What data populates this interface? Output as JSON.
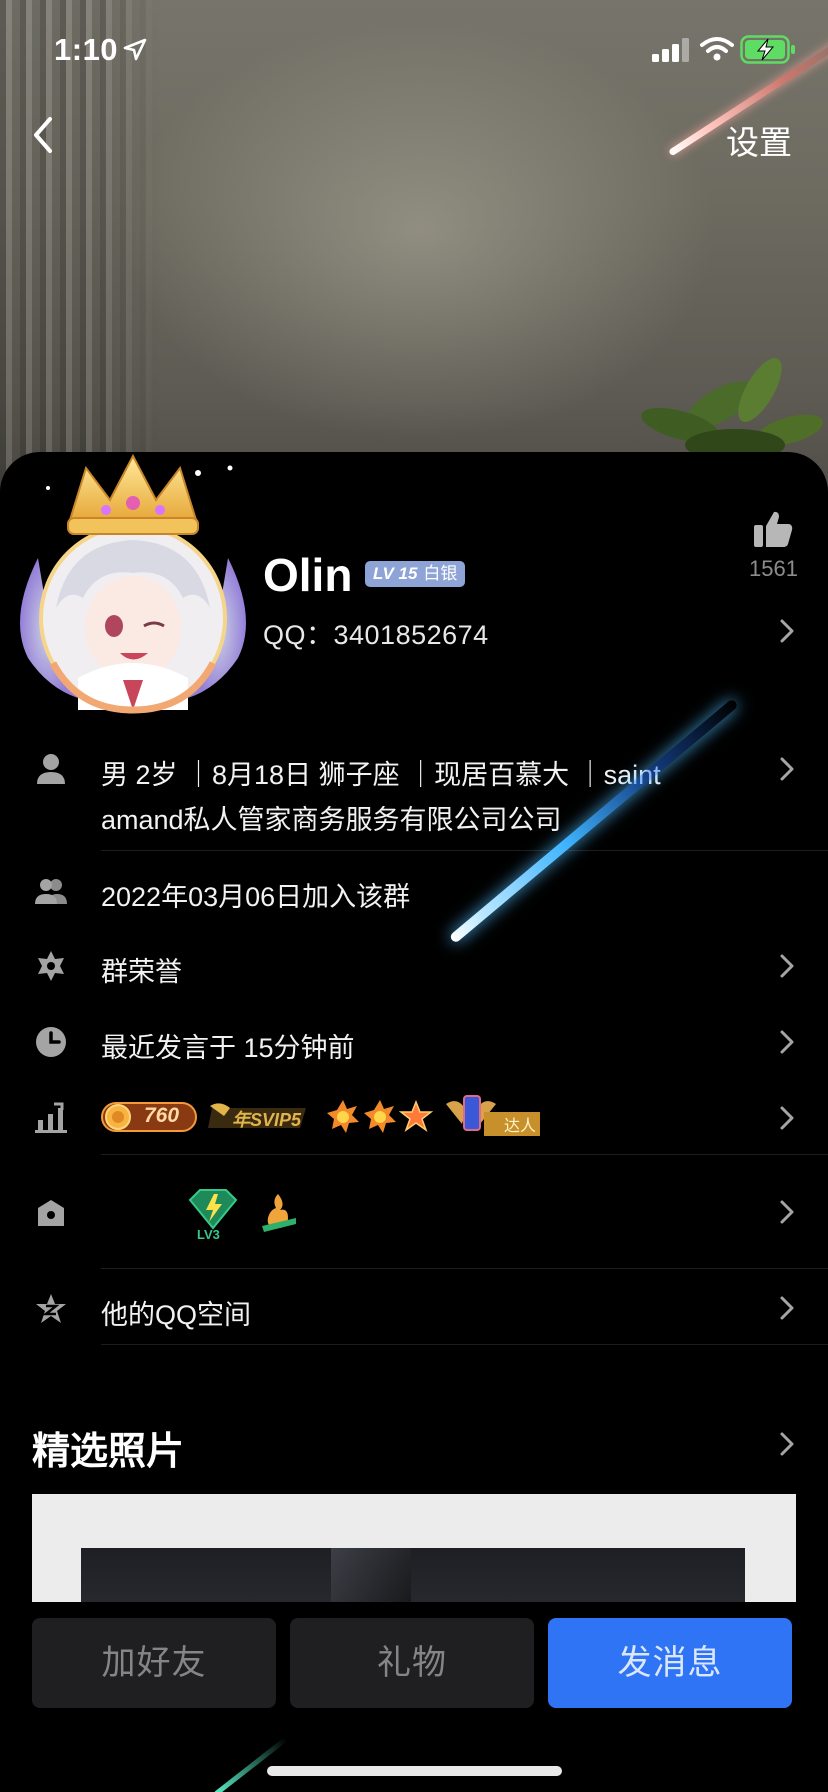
{
  "status_bar": {
    "time": "1:10"
  },
  "nav": {
    "settings_label": "设置"
  },
  "profile": {
    "nickname": "Olin",
    "level_badge": {
      "level": "LV 15",
      "tier": "白银"
    },
    "qq_id": "QQ：3401852674",
    "likes": "1561"
  },
  "info_rows": {
    "basic_line1": "男 2岁 ｜8月18日 狮子座 ｜现居百慕大 ｜saint",
    "basic_line2": "amand私人管家商务服务有限公司公司",
    "join_date": "2022年03月06日加入该群",
    "group_honor": "群荣誉",
    "last_speak": "最近发言于 15分钟前",
    "badges": {
      "coin_count": "760",
      "svip": "年SVIP5",
      "daren": "达人"
    },
    "privilege": {
      "lv3": "LV3"
    },
    "qzone": "他的QQ空间"
  },
  "photos_section": {
    "title": "精选照片"
  },
  "actions": {
    "add_friend": "加好友",
    "gift": "礼物",
    "send_message": "发消息"
  },
  "colors": {
    "accent_blue": "#2f74f5",
    "button_gray": "#1f1f21",
    "level_badge": "#8ea3d6"
  }
}
